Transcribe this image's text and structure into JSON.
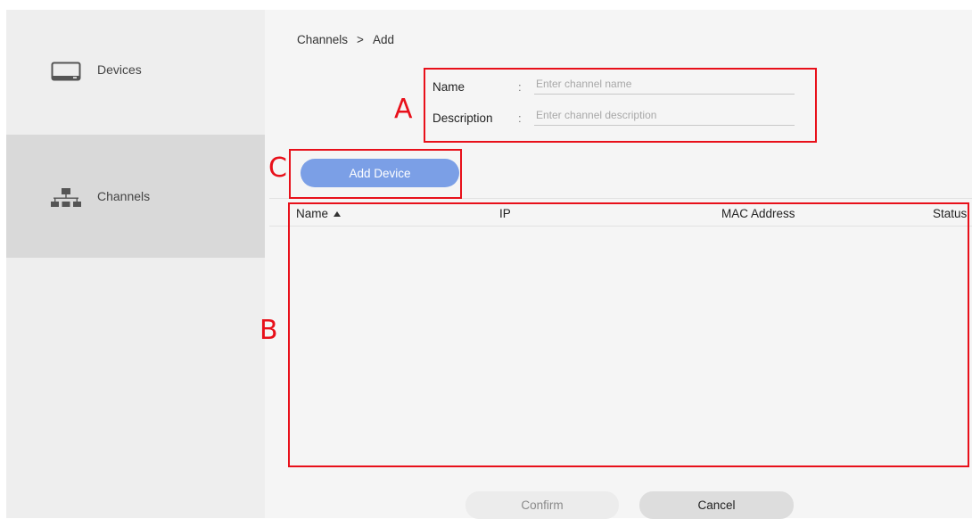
{
  "sidebar": {
    "items": [
      {
        "label": "Devices",
        "icon": "monitor-icon",
        "selected": false
      },
      {
        "label": "Channels",
        "icon": "network-icon",
        "selected": true
      }
    ]
  },
  "breadcrumb": {
    "parent": "Channels",
    "separator": ">",
    "current": "Add"
  },
  "form": {
    "name_label": "Name",
    "name_colon": ":",
    "name_placeholder": "Enter channel name",
    "description_label": "Description",
    "description_colon": ":",
    "description_placeholder": "Enter channel description"
  },
  "add_device_label": "Add Device",
  "table": {
    "columns": [
      "Name",
      "IP",
      "MAC Address",
      "Status"
    ],
    "sort_column": "Name",
    "sort_direction": "ascending",
    "rows": []
  },
  "annotations": {
    "a": "A",
    "b": "B",
    "c": "C",
    "color": "#e8101a"
  },
  "footer": {
    "confirm_label": "Confirm",
    "cancel_label": "Cancel"
  },
  "colors": {
    "accent": "#7b9fe6",
    "sidebar_selected": "#d9d9d9"
  }
}
